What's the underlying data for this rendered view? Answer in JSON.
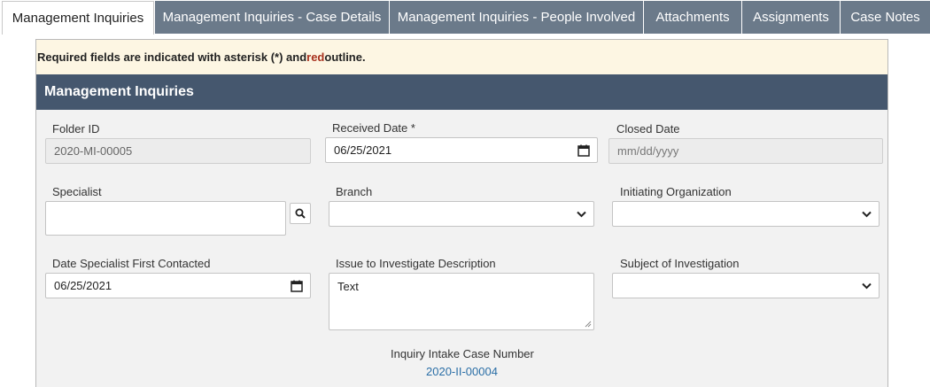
{
  "tabs": [
    {
      "label": "Management Inquiries",
      "active": true
    },
    {
      "label": "Management Inquiries - Case Details",
      "active": false
    },
    {
      "label": "Management Inquiries - People Involved",
      "active": false
    },
    {
      "label": "Attachments",
      "active": false
    },
    {
      "label": "Assignments",
      "active": false
    },
    {
      "label": "Case Notes",
      "active": false
    }
  ],
  "notice": {
    "prefix": "Required fields are indicated with asterisk (*) and ",
    "red_word": "red",
    "suffix": " outline."
  },
  "section_title": "Management Inquiries",
  "fields": {
    "folder_id": {
      "label": "Folder ID",
      "value": "2020-MI-00005"
    },
    "received_date": {
      "label": "Received Date *",
      "value": "06/25/2021"
    },
    "closed_date": {
      "label": "Closed Date",
      "placeholder": "mm/dd/yyyy"
    },
    "specialist": {
      "label": "Specialist",
      "value": ""
    },
    "branch": {
      "label": "Branch",
      "value": ""
    },
    "initiating_org": {
      "label": "Initiating Organization",
      "value": ""
    },
    "date_first_contacted": {
      "label": "Date Specialist First Contacted",
      "value": "06/25/2021"
    },
    "issue_description": {
      "label": "Issue to Investigate Description",
      "value": "Text"
    },
    "subject": {
      "label": "Subject of Investigation",
      "value": ""
    },
    "intake_case": {
      "label": "Inquiry Intake Case Number",
      "value": "2020-II-00004"
    }
  },
  "colors": {
    "tab_inactive": "#6b7a8a",
    "section_header": "#45576e",
    "notice_bg": "#fdf6e3",
    "required_red": "#a8321f",
    "link": "#2a6ea6"
  },
  "icons": {
    "calendar": "calendar-icon",
    "chevron": "chevron-down-icon",
    "search": "search-icon"
  }
}
